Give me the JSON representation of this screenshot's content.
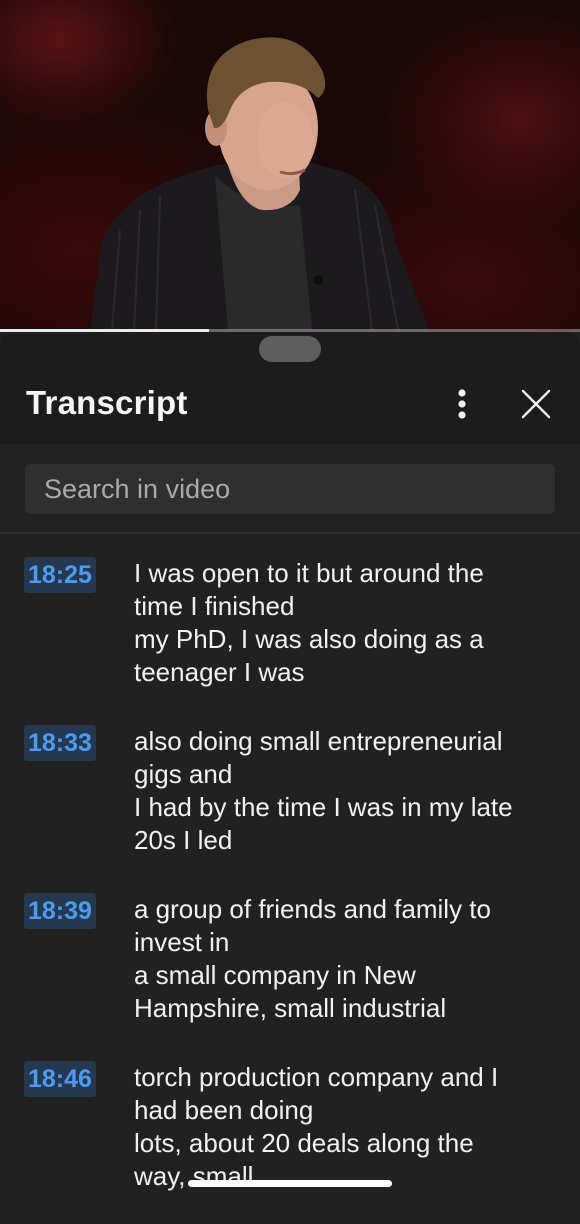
{
  "video": {
    "progress": 0.36
  },
  "panel": {
    "title": "Transcript",
    "more_icon": "vertical-ellipsis-icon",
    "close_icon": "close-icon"
  },
  "search": {
    "placeholder": "Search in video"
  },
  "segments": [
    {
      "time": "18:25",
      "lines": [
        "I was open to it but around the",
        "time I finished",
        "my PhD, I was also doing as a",
        "teenager I was"
      ]
    },
    {
      "time": "18:33",
      "lines": [
        "also doing small entrepreneurial",
        "gigs and",
        "I had by the time I was in my late",
        "20s I led"
      ]
    },
    {
      "time": "18:39",
      "lines": [
        "a group of friends and family to",
        "invest in",
        "a small company in New",
        "Hampshire, small industrial"
      ]
    },
    {
      "time": "18:46",
      "lines": [
        "torch production company and I",
        "had been doing",
        "lots, about 20 deals along the",
        "way, small"
      ]
    }
  ],
  "colors": {
    "timestamp_text": "#4d9bf0",
    "timestamp_bg": "#263850",
    "panel_bg": "#212121"
  }
}
